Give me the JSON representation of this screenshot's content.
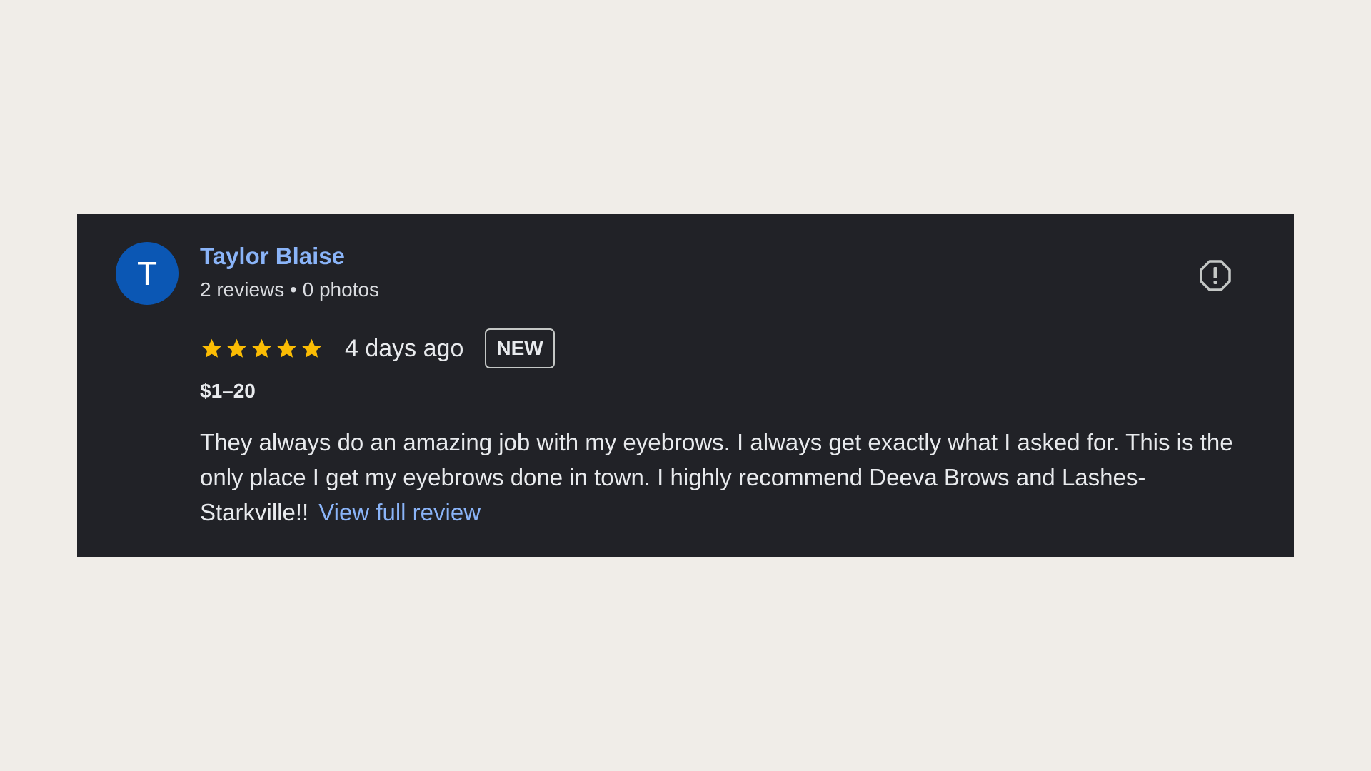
{
  "review": {
    "avatar_letter": "T",
    "author_name": "Taylor Blaise",
    "author_meta": "2 reviews • 0 photos",
    "rating": 5,
    "rating_max": 5,
    "date": "4 days ago",
    "badge": "NEW",
    "price": "$1–20",
    "text": "They always do an amazing job with my eyebrows. I always get exactly what I asked for. This is the only place I get my eyebrows done in town. I highly recommend Deeva Brows and Lashes-Starkville!!",
    "view_full_label": "View full review"
  },
  "icons": {
    "report": "report-octagon-icon",
    "star": "star-icon"
  },
  "colors": {
    "page_background": "#f0ede8",
    "card_background": "#212227",
    "avatar": "#0b57b4",
    "link": "#8ab4f8",
    "star": "#fbbc04",
    "text": "#e8eaed"
  }
}
